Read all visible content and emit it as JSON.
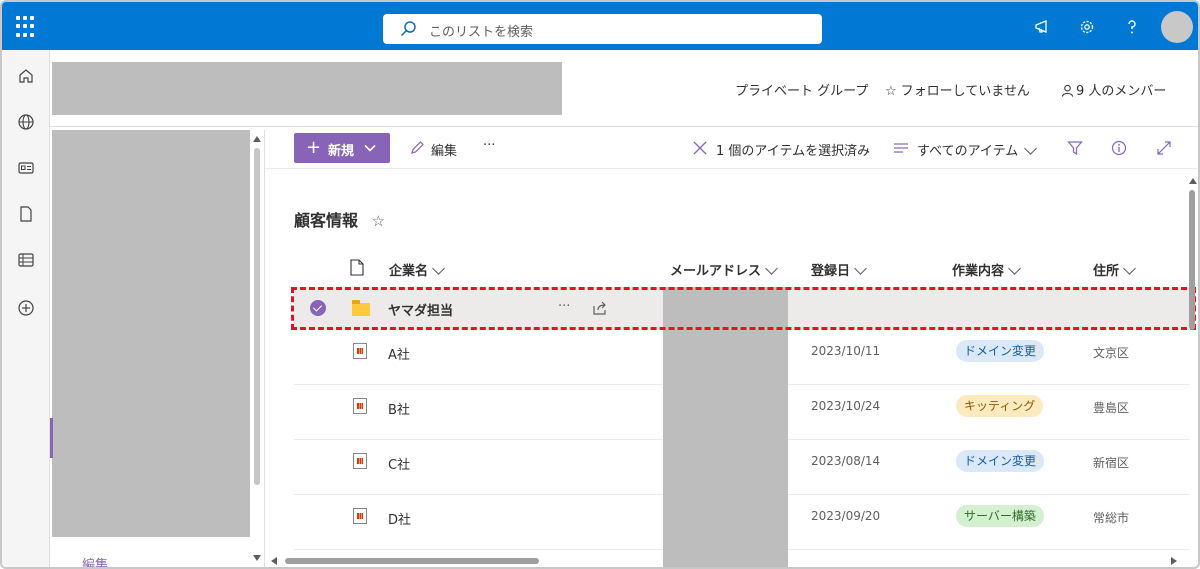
{
  "search": {
    "placeholder": "このリストを検索"
  },
  "site_header": {
    "privacy": "プライベート グループ",
    "follow": "フォローしていません",
    "members": "9 人のメンバー"
  },
  "sitenav": {
    "edit_label": "編集"
  },
  "commandbar": {
    "new_label": "新規",
    "edit_label": "編集",
    "more_label": "···",
    "selection_status": "1 個のアイテムを選択済み",
    "view_label": "すべてのアイテム"
  },
  "list": {
    "title": "顧客情報",
    "columns": [
      "企業名",
      "メールアドレス",
      "登録日",
      "作業内容",
      "住所"
    ],
    "folder_row": {
      "name": "ヤマダ担当",
      "more": "···"
    },
    "rows": [
      {
        "company": "A社",
        "date": "2023/10/11",
        "work": "ドメイン変更",
        "address": "文京区"
      },
      {
        "company": "B社",
        "date": "2023/10/24",
        "work": "キッティング",
        "address": "豊島区"
      },
      {
        "company": "C社",
        "date": "2023/08/14",
        "work": "ドメイン変更",
        "address": "新宿区"
      },
      {
        "company": "D社",
        "date": "2023/09/20",
        "work": "サーバー構築",
        "address": "常総市"
      }
    ]
  },
  "colors": {
    "suite_blue": "#0078d4",
    "accent_purple": "#8764b8",
    "selection_outline": "#e81123",
    "tag_domain_bg": "#dbe8f7",
    "tag_domain_fg": "#0f5ea8",
    "tag_kitting_bg": "#fdeabf",
    "tag_kitting_fg": "#8a5a00",
    "tag_server_bg": "#d5f0d0",
    "tag_server_fg": "#2f6e2a"
  }
}
